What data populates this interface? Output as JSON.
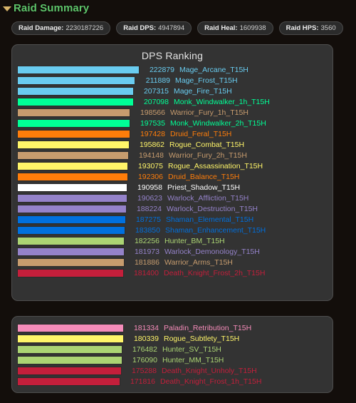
{
  "header": {
    "disclosure_icon": "triangle-down-icon",
    "title": "Raid Summary",
    "title_color": "#5ec46a"
  },
  "stats": [
    {
      "label": "Raid Damage:",
      "value": "2230187226"
    },
    {
      "label": "Raid DPS:",
      "value": "4947894"
    },
    {
      "label": "Raid Heal:",
      "value": "1609938"
    },
    {
      "label": "Raid HPS:",
      "value": "3560"
    }
  ],
  "chart_data": {
    "type": "bar",
    "title": "DPS Ranking",
    "orientation": "horizontal",
    "xlabel": "",
    "ylabel": "",
    "grid": false,
    "legend": false,
    "xlim": [
      0,
      222879
    ],
    "panels": [
      {
        "name": "dps-ranking-main",
        "title": "DPS Ranking",
        "categories": [
          "Mage_Arcane_T15H",
          "Mage_Frost_T15H",
          "Mage_Fire_T15H",
          "Monk_Windwalker_1h_T15H",
          "Warrior_Fury_1h_T15H",
          "Monk_Windwalker_2h_T15H",
          "Druid_Feral_T15H",
          "Rogue_Combat_T15H",
          "Warrior_Fury_2h_T15H",
          "Rogue_Assassination_T15H",
          "Druid_Balance_T15H",
          "Priest_Shadow_T15H",
          "Warlock_Affliction_T15H",
          "Warlock_Destruction_T15H",
          "Shaman_Elemental_T15H",
          "Shaman_Enhancement_T15H",
          "Hunter_BM_T15H",
          "Warlock_Demonology_T15H",
          "Warrior_Arms_T15H",
          "Death_Knight_Frost_2h_T15H"
        ],
        "values": [
          222879,
          211889,
          207315,
          207098,
          198566,
          197535,
          197428,
          195862,
          194148,
          193075,
          192306,
          190958,
          190623,
          188224,
          187275,
          183850,
          182256,
          181973,
          181886,
          181400
        ],
        "bar_colors": [
          "#69ccf0",
          "#69ccf0",
          "#69ccf0",
          "#00ff96",
          "#c79c6e",
          "#00ff96",
          "#ff7d0a",
          "#fff569",
          "#c79c6e",
          "#fff569",
          "#ff7d0a",
          "#ffffff",
          "#9482c9",
          "#9482c9",
          "#0070de",
          "#0070de",
          "#abd473",
          "#9482c9",
          "#c79c6e",
          "#c41f3b"
        ],
        "text_colors": [
          "#69ccf0",
          "#69ccf0",
          "#69ccf0",
          "#00ff96",
          "#c79c6e",
          "#00ff96",
          "#ff7d0a",
          "#fff569",
          "#c79c6e",
          "#fff569",
          "#ff7d0a",
          "#ffffff",
          "#9482c9",
          "#9482c9",
          "#0070de",
          "#0070de",
          "#abd473",
          "#9482c9",
          "#c79c6e",
          "#c41f3b"
        ]
      },
      {
        "name": "dps-ranking-continued",
        "title": "",
        "categories": [
          "Paladin_Retribution_T15H",
          "Rogue_Subtlety_T15H",
          "Hunter_SV_T15H",
          "Hunter_MM_T15H",
          "Death_Knight_Unholy_T15H",
          "Death_Knight_Frost_1h_T15H"
        ],
        "values": [
          181334,
          180339,
          176482,
          176090,
          175288,
          171816
        ],
        "bar_colors": [
          "#f58cba",
          "#fff569",
          "#abd473",
          "#abd473",
          "#c41f3b",
          "#c41f3b"
        ],
        "text_colors": [
          "#f58cba",
          "#fff569",
          "#abd473",
          "#abd473",
          "#c41f3b",
          "#c41f3b"
        ]
      }
    ]
  }
}
